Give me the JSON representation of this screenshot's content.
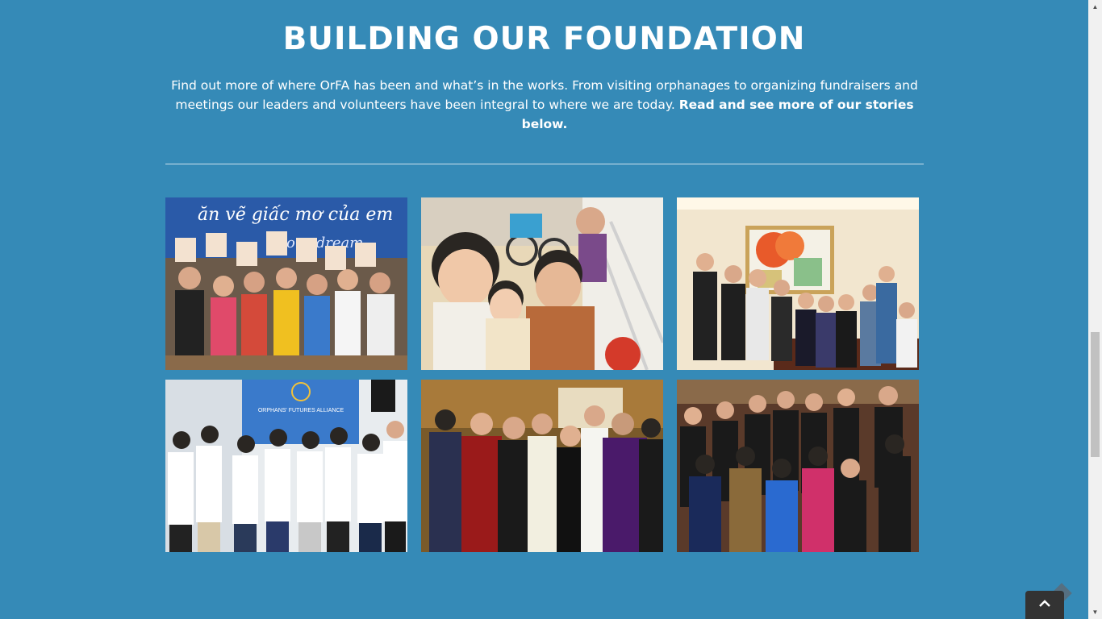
{
  "section": {
    "title": "BUILDING OUR FOUNDATION",
    "intro_text": "Find out more of where OrFA has been and what’s in the works. From visiting orphanages to organizing fundraisers and meetings our leaders and volunteers have been integral to where we are today.",
    "intro_bold": "Read and see more of our stories below."
  },
  "gallery": {
    "photos": [
      {
        "name": "children-holding-letters-photo",
        "banner_text": "ăn vẽ giấc mơ của em",
        "banner_text_2": "our dream"
      },
      {
        "name": "young-children-closeup-photo"
      },
      {
        "name": "team-meeting-room-photo"
      },
      {
        "name": "volunteers-banner-photo",
        "banner_text": "ORPHANS' FUTURES ALLIANCE"
      },
      {
        "name": "fundraiser-event-photo"
      },
      {
        "name": "gala-group-photo"
      }
    ]
  },
  "icons": {
    "scroll_up": "▲",
    "scroll_down": "▼",
    "to_top": "chevron-up-icon"
  },
  "colors": {
    "background": "#358ab7",
    "text": "#ffffff",
    "to_top_button": "#333333"
  }
}
